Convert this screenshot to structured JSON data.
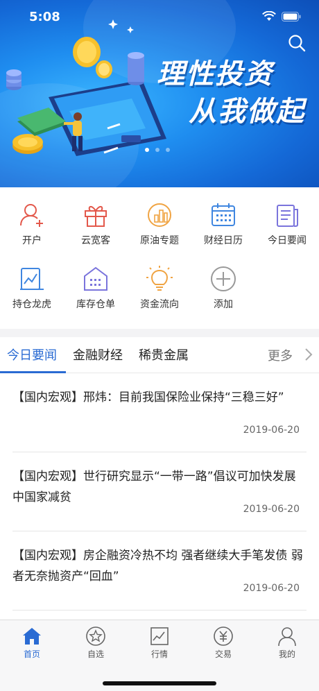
{
  "status_bar": {
    "time": "5:08",
    "icons": [
      "wifi-icon",
      "battery-icon"
    ]
  },
  "banner": {
    "slogan_line1": "理性投资",
    "slogan_line2": "从我做起",
    "search_icon": "search-icon",
    "carousel": {
      "pages": 3,
      "active": 0
    }
  },
  "quick_grid": [
    {
      "label": "开户",
      "icon": "user-add-icon",
      "color": "#e3584b"
    },
    {
      "label": "云宽客",
      "icon": "gift-icon",
      "color": "#e3584b"
    },
    {
      "label": "原油专题",
      "icon": "oil-chart-icon",
      "color": "#f0a443"
    },
    {
      "label": "财经日历",
      "icon": "calendar-icon",
      "color": "#3f86e0"
    },
    {
      "label": "今日要闻",
      "icon": "news-icon",
      "color": "#7a74dc"
    },
    {
      "label": "持仓龙虎",
      "icon": "holdings-chart-icon",
      "color": "#3f86e0"
    },
    {
      "label": "库存仓单",
      "icon": "warehouse-icon",
      "color": "#7a74dc"
    },
    {
      "label": "资金流向",
      "icon": "lightbulb-icon",
      "color": "#f0a443"
    },
    {
      "label": "添加",
      "icon": "plus-icon",
      "color": "#999999"
    }
  ],
  "news_tabs": {
    "tabs": [
      "今日要闻",
      "金融财经",
      "稀贵金属"
    ],
    "active_index": 0,
    "more_label": "更多"
  },
  "news": [
    {
      "title": "【国内宏观】邢炜：目前我国保险业保持“三稳三好”",
      "date": "2019-06-20"
    },
    {
      "title": "【国内宏观】世行研究显示“一带一路”倡议可加快发展中国家减贫",
      "date": "2019-06-20"
    },
    {
      "title": "【国内宏观】房企融资冷热不均 强者继续大手笔发债 弱者无奈抛资产“回血”",
      "date": "2019-06-20"
    }
  ],
  "bottom_nav": [
    {
      "label": "首页",
      "icon": "home-icon",
      "active": true
    },
    {
      "label": "自选",
      "icon": "star-icon",
      "active": false
    },
    {
      "label": "行情",
      "icon": "market-chart-icon",
      "active": false
    },
    {
      "label": "交易",
      "icon": "yuan-icon",
      "active": false
    },
    {
      "label": "我的",
      "icon": "profile-icon",
      "active": false
    }
  ],
  "colors": {
    "accent": "#2a6bd3",
    "banner_blue": "#1f8ef0"
  }
}
